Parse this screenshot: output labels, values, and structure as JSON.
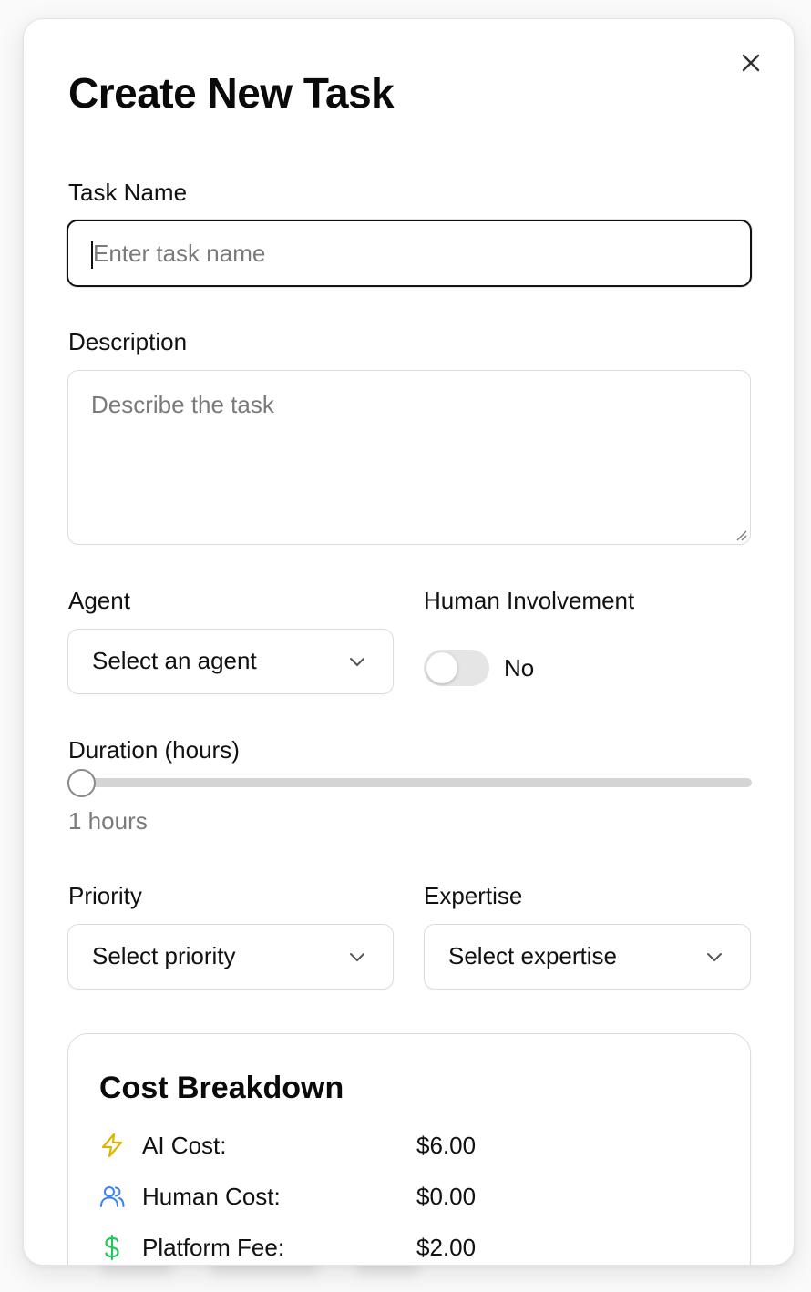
{
  "dialog": {
    "title": "Create New Task",
    "close_label": "×"
  },
  "fields": {
    "task_name": {
      "label": "Task Name",
      "placeholder": "Enter task name",
      "value": ""
    },
    "description": {
      "label": "Description",
      "placeholder": "Describe the task",
      "value": ""
    },
    "agent": {
      "label": "Agent",
      "selected": "Select an agent"
    },
    "human_involvement": {
      "label": "Human Involvement",
      "enabled": false,
      "state_text": "No"
    },
    "duration": {
      "label": "Duration (hours)",
      "value": 1,
      "value_text": "1 hours"
    },
    "priority": {
      "label": "Priority",
      "selected": "Select priority"
    },
    "expertise": {
      "label": "Expertise",
      "selected": "Select expertise"
    }
  },
  "cost_breakdown": {
    "title": "Cost Breakdown",
    "rows": [
      {
        "icon": "lightning-icon",
        "label": "AI Cost:",
        "value": "$6.00",
        "color": "#e0b400"
      },
      {
        "icon": "users-icon",
        "label": "Human Cost:",
        "value": "$0.00",
        "color": "#3b82f6"
      },
      {
        "icon": "dollar-icon",
        "label": "Platform Fee:",
        "value": "$2.00",
        "color": "#22c55e"
      }
    ]
  }
}
